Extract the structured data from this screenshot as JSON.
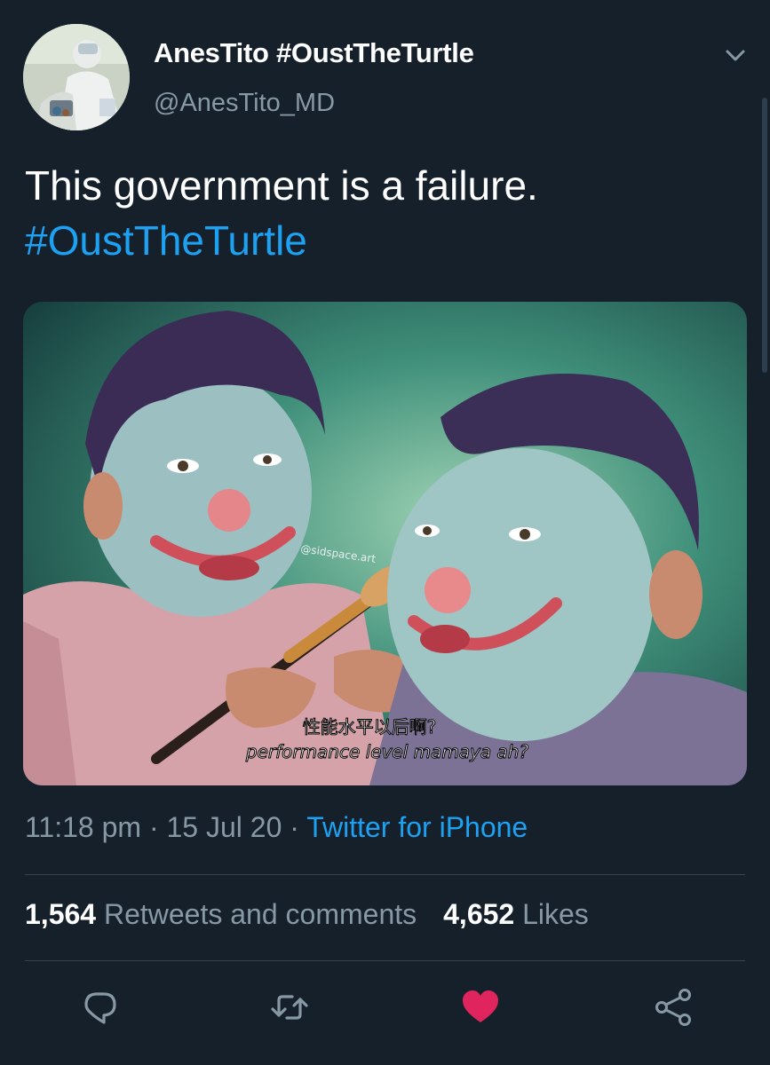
{
  "tweet": {
    "display_name": "AnesTito #OustTheTurtle",
    "handle": "@AnesTito_MD",
    "text_plain": "This government is a failure.",
    "text_hashtag": "#OustTheTurtle",
    "media": {
      "watermark": "@sidspace.art",
      "caption_chinese": "性能水平以后啊?",
      "caption_english": "performance level mamaya ah?"
    },
    "time": "11:18 pm",
    "date": "15 Jul 20",
    "separator": " · ",
    "source": "Twitter for iPhone",
    "retweets_count": "1,564",
    "retweets_label": "Retweets and comments",
    "likes_count": "4,652",
    "likes_label": "Likes"
  },
  "icons": {
    "caret": "chevron-down-icon",
    "reply": "reply-icon",
    "retweet": "retweet-icon",
    "like": "heart-icon",
    "share": "share-icon"
  },
  "colors": {
    "background": "#15202b",
    "link": "#1da1f2",
    "secondary_text": "#8899a6",
    "divider": "#38444d",
    "like_active": "#e0245e"
  }
}
